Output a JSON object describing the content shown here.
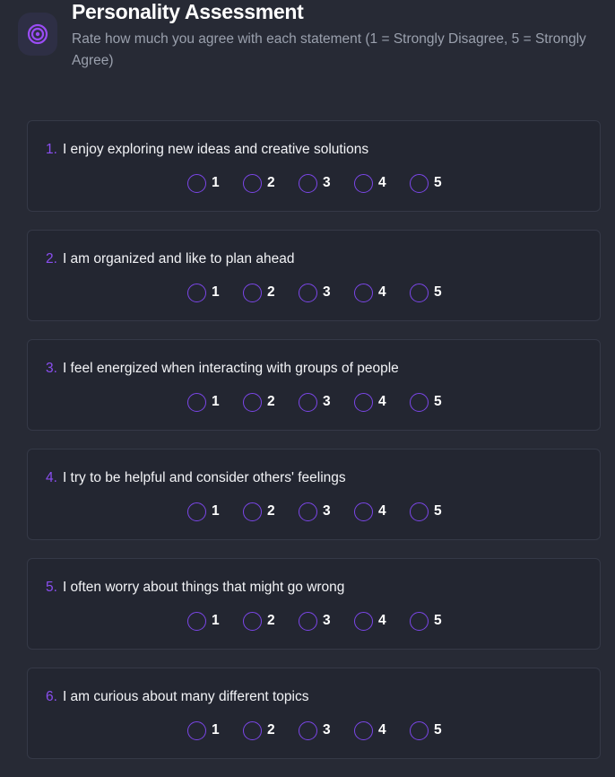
{
  "header": {
    "logo_icon": "target-icon",
    "title": "Personality Assessment",
    "subtitle": "Rate how much you agree with each statement (1 = Strongly Disagree, 5 = Strongly Agree)"
  },
  "accent_color": "#8a4ef0",
  "scale_options": [
    "1",
    "2",
    "3",
    "4",
    "5"
  ],
  "questions": [
    {
      "number": "1.",
      "text": "I enjoy exploring new ideas and creative solutions"
    },
    {
      "number": "2.",
      "text": "I am organized and like to plan ahead"
    },
    {
      "number": "3.",
      "text": "I feel energized when interacting with groups of people"
    },
    {
      "number": "4.",
      "text": "I try to be helpful and consider others' feelings"
    },
    {
      "number": "5.",
      "text": "I often worry about things that might go wrong"
    },
    {
      "number": "6.",
      "text": "I am curious about many different topics"
    }
  ]
}
